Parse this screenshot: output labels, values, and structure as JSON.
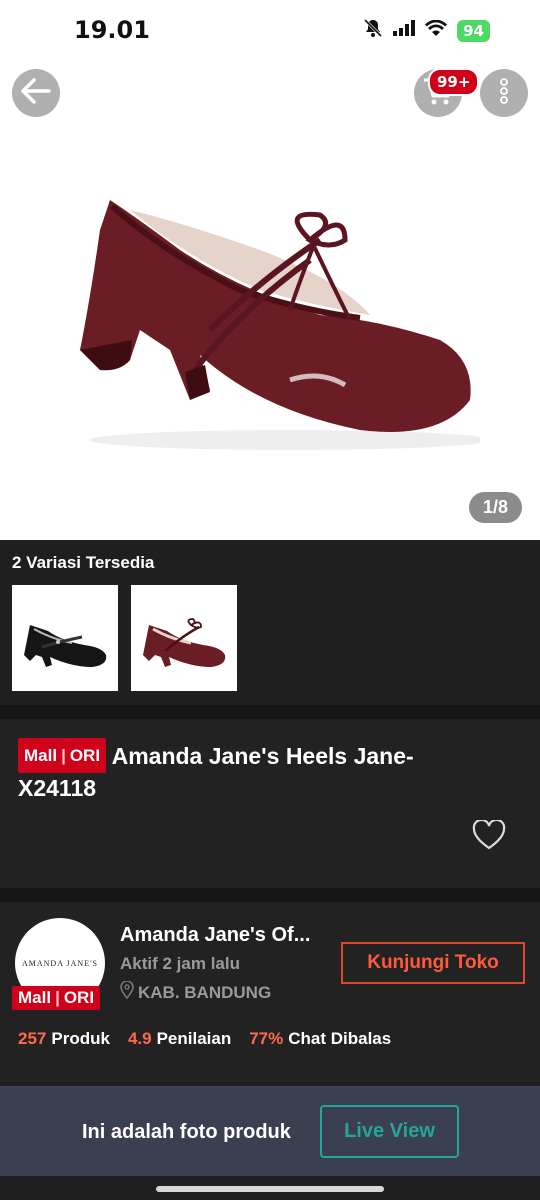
{
  "status_bar": {
    "time": "19.01",
    "battery": "94"
  },
  "header": {
    "cart_badge": "99+"
  },
  "gallery": {
    "counter": "1/8"
  },
  "variants": {
    "title": "2 Variasi Tersedia"
  },
  "mall_badge": {
    "left": "Mall",
    "right": "ORI"
  },
  "product": {
    "title": "Amanda  Jane's Heels Jane-X24118"
  },
  "shop": {
    "avatar_text": "AMANDA JANE'S",
    "name": "Amanda Jane's Of...",
    "active": "Aktif 2 jam lalu",
    "location": "KAB. BANDUNG",
    "visit_label": "Kunjungi Toko",
    "stats": [
      {
        "value": "257",
        "label": "Produk"
      },
      {
        "value": "4.9",
        "label": "Penilaian"
      },
      {
        "value": "77%",
        "label": "Chat Dibalas"
      }
    ]
  },
  "banner": {
    "text": "Ini adalah foto produk",
    "button": "Live View"
  },
  "colors": {
    "accent": "#ff5a3c",
    "mall_red": "#d0011b",
    "live_teal": "#26a69a",
    "shoe": "#6b1d26"
  }
}
